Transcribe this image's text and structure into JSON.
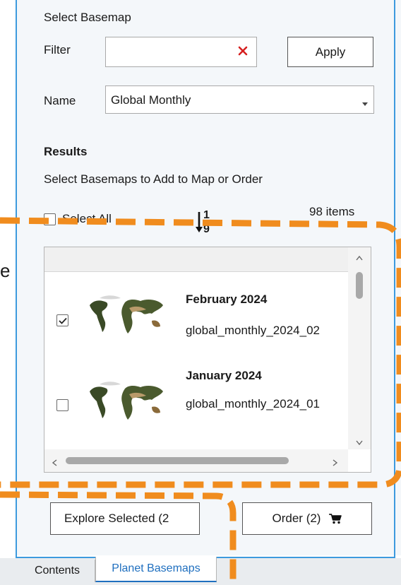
{
  "panel": {
    "section_title": "Select Basemap",
    "filter": {
      "label": "Filter",
      "value": "",
      "placeholder": ""
    },
    "apply_label": "Apply",
    "name": {
      "label": "Name",
      "selected": "Global Monthly"
    }
  },
  "results": {
    "heading": "Results",
    "subheading": "Select Basemaps to Add to Map or Order",
    "select_all_label": "Select All",
    "sort_glyph_top": "1",
    "sort_glyph_bottom": "9",
    "count": "98 items",
    "items": [
      {
        "title": "February 2024",
        "subtitle": "global_monthly_2024_02",
        "checked": true
      },
      {
        "title": "January 2024",
        "subtitle": "global_monthly_2024_01",
        "checked": false
      }
    ]
  },
  "footer": {
    "explore_label": "Explore Selected (2",
    "order_label": "Order (2)"
  },
  "tabs": [
    {
      "label": "Contents"
    },
    {
      "label": "Planet Basemaps"
    }
  ],
  "stray_text": "e",
  "colors": {
    "accent": "#3d9ade",
    "tab_active_text": "#1f6fbf",
    "highlight_dash": "#f08c1e",
    "clear_x": "#d62020"
  },
  "icons": {
    "clear": "close-icon",
    "dropdown": "chevron-down-icon",
    "sort": "sort-numeric-icon",
    "cart": "cart-icon"
  }
}
